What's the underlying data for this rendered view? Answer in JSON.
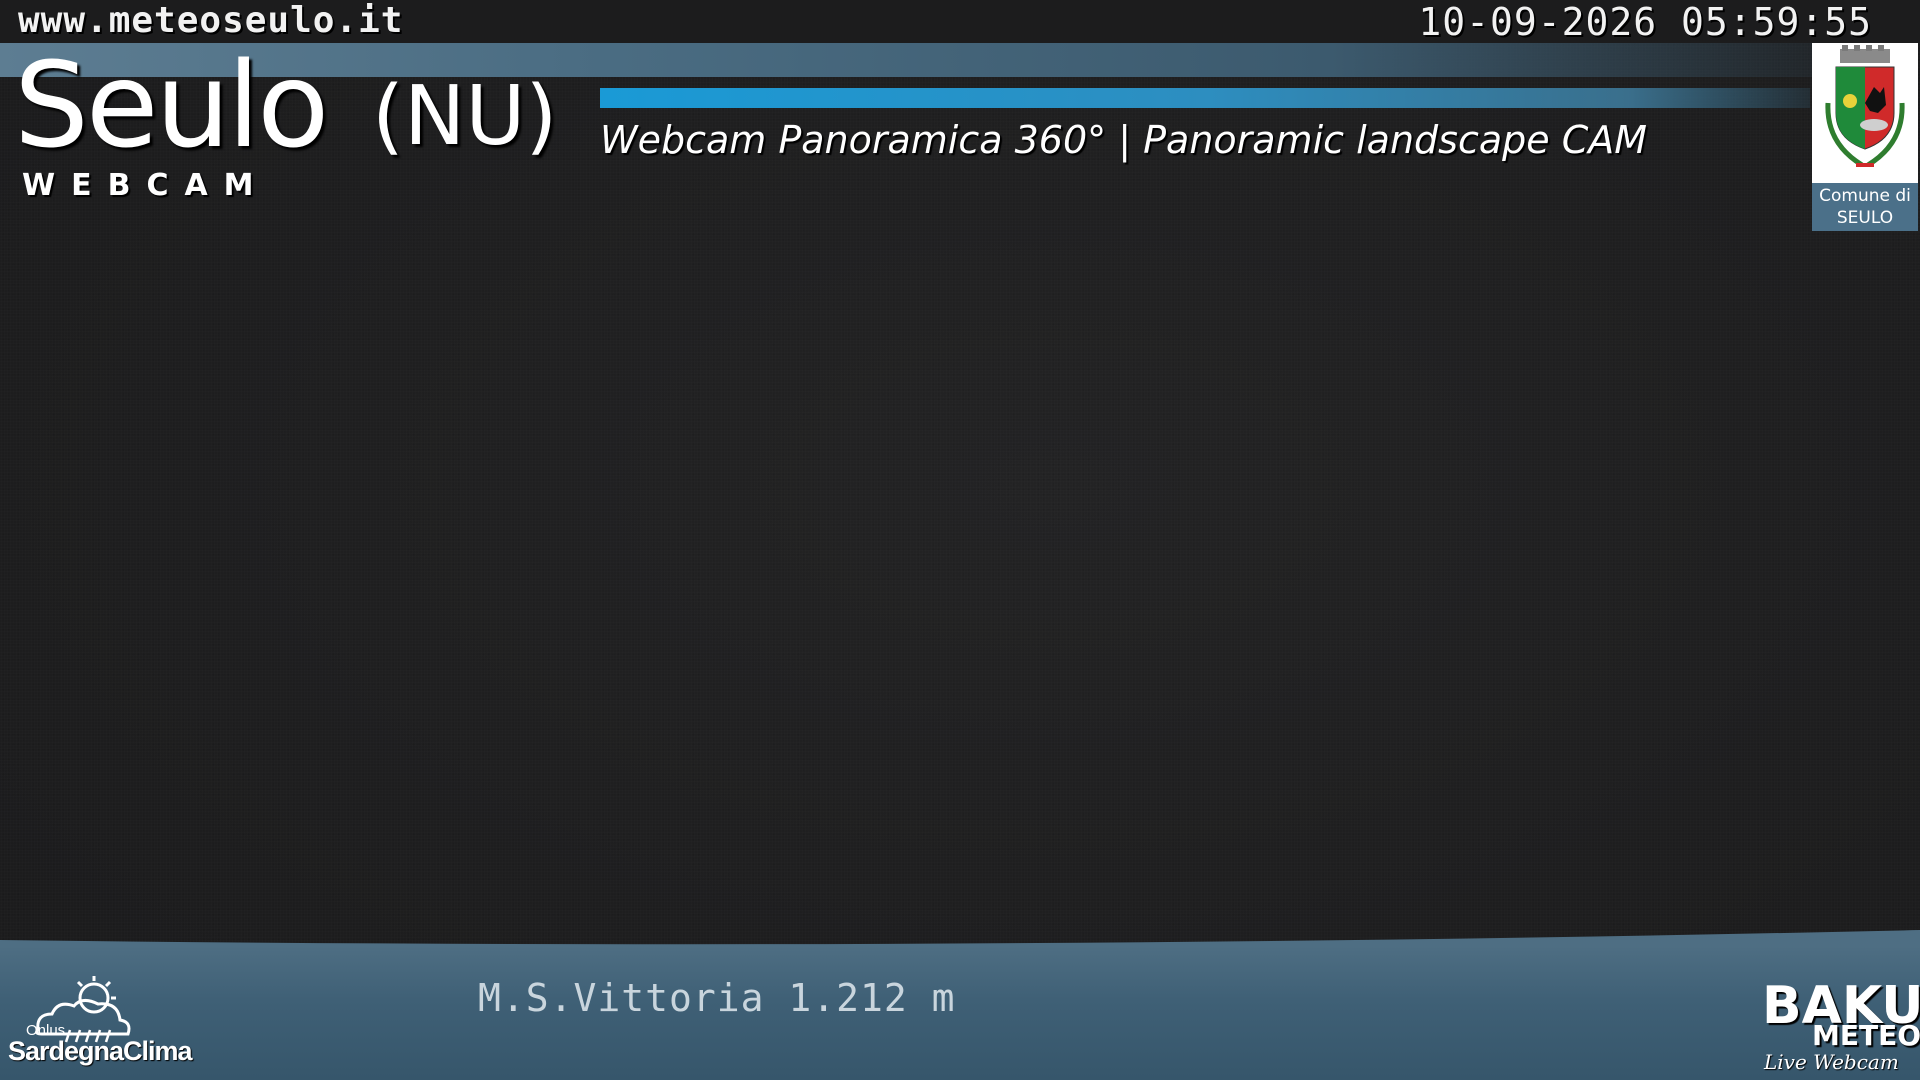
{
  "overlay": {
    "url": "www.meteoseulo.it",
    "datetime": "10-09-2026 05:59:55",
    "title": "Seulo",
    "province": "(NU)",
    "subtitle": "WEBCAM",
    "tagline": "Webcam Panoramica 360°  | Panoramic landscape CAM",
    "crest_caption_line1": "Comune di",
    "crest_caption_line2": "SEULO",
    "location": "M.S.Vittoria 1.212 m"
  },
  "logos": {
    "left_org_small": "Onlus",
    "left_org_name": "SardegnaClima",
    "right_brand_top": "BAKU",
    "right_brand_bottom": "METEO",
    "right_brand_tagline": "Live Webcam"
  },
  "colors": {
    "sky": "#1f1f20",
    "band": "#4b6d83",
    "accent_bar": "#1a9ad6",
    "text": "#ffffff"
  },
  "icons": [
    "comune-crest-icon",
    "sardegnaclima-cloud-sun-icon",
    "bakumeteo-logo-icon"
  ]
}
